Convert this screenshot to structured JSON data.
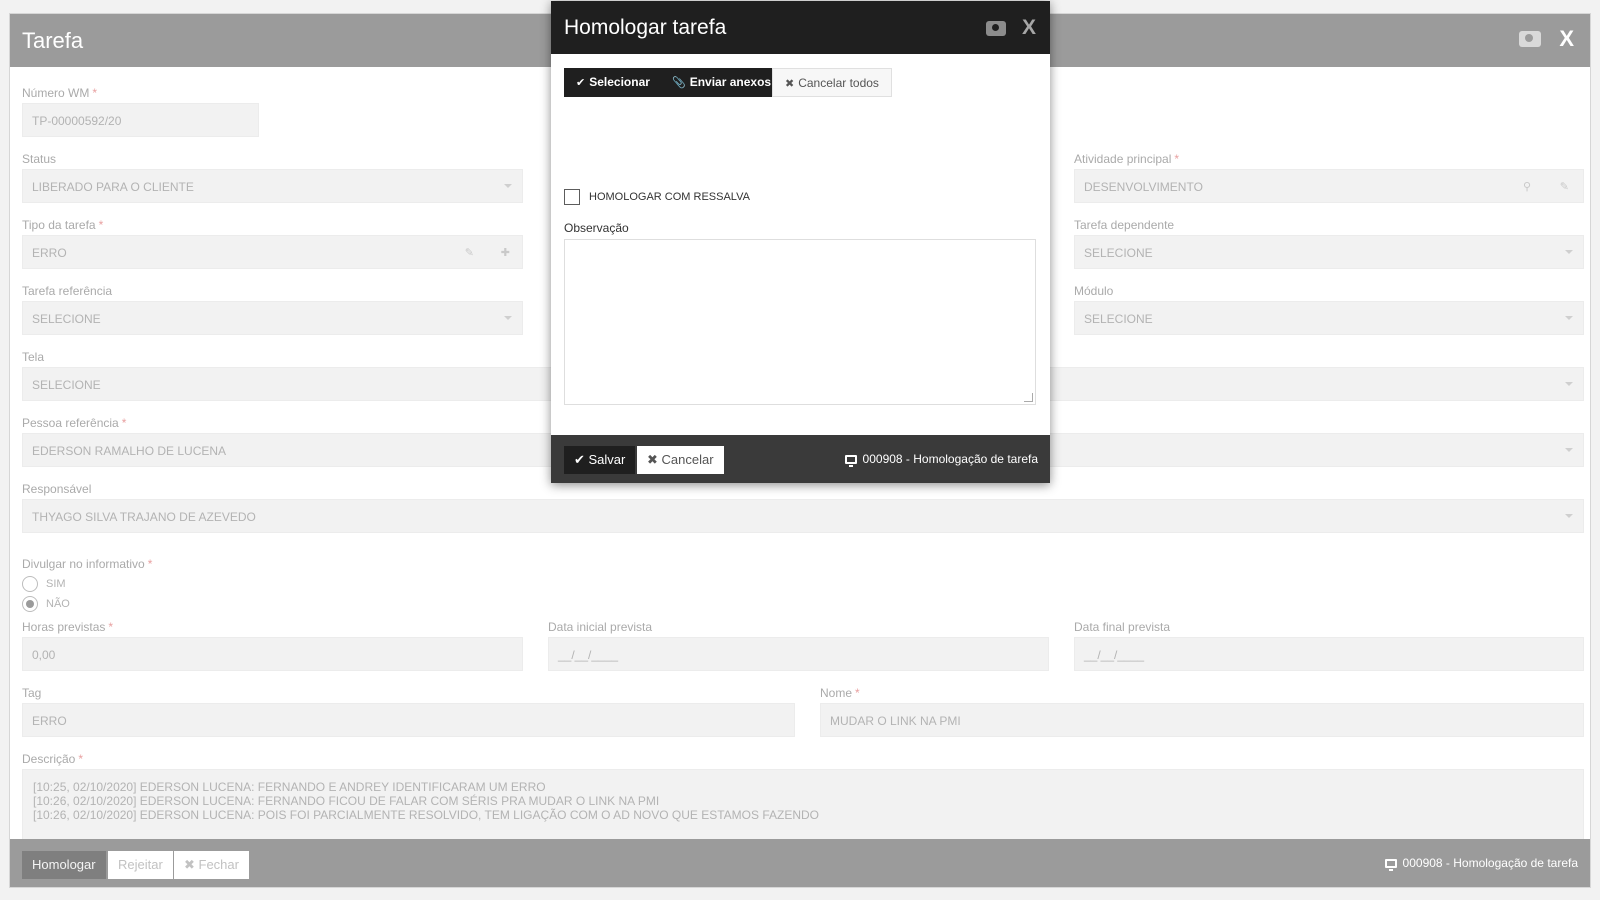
{
  "window": {
    "title": "Tarefa",
    "footer_info": "000908 - Homologação de tarefa",
    "buttons": {
      "homologar": "Homologar",
      "rejeitar": "Rejeitar",
      "fechar": "Fechar"
    }
  },
  "fields": {
    "numero_wm": {
      "label": "Número WM",
      "value": "TP-00000592/20"
    },
    "status": {
      "label": "Status",
      "value": "LIBERADO PARA O CLIENTE"
    },
    "atividade_principal": {
      "label": "Atividade principal",
      "value": "DESENVOLVIMENTO"
    },
    "tipo_tarefa": {
      "label": "Tipo da tarefa",
      "value": "ERRO"
    },
    "tarefa_dependente": {
      "label": "Tarefa dependente",
      "value": "SELECIONE"
    },
    "tarefa_referencia": {
      "label": "Tarefa referência",
      "value": "SELECIONE"
    },
    "modulo": {
      "label": "Módulo",
      "value": "SELECIONE"
    },
    "tela": {
      "label": "Tela",
      "value": "SELECIONE"
    },
    "pessoa_referencia": {
      "label": "Pessoa referência",
      "value": "EDERSON RAMALHO DE LUCENA"
    },
    "responsavel": {
      "label": "Responsável",
      "value": "THYAGO SILVA TRAJANO DE AZEVEDO"
    },
    "divulgar": {
      "label": "Divulgar no informativo",
      "options": [
        "SIM",
        "NÃO"
      ],
      "selected": "NÃO"
    },
    "horas_previstas": {
      "label": "Horas previstas",
      "value": "0,00"
    },
    "data_inicial": {
      "label": "Data inicial prevista",
      "value": "__/__/____"
    },
    "data_final": {
      "label": "Data final prevista",
      "value": "__/__/____"
    },
    "tag": {
      "label": "Tag",
      "value": "ERRO"
    },
    "nome": {
      "label": "Nome",
      "value": "MUDAR O LINK NA PMI"
    },
    "descricao": {
      "label": "Descrição",
      "lines": [
        "[10:25, 02/10/2020] EDERSON LUCENA: FERNANDO E ANDREY IDENTIFICARAM UM ERRO",
        "[10:26, 02/10/2020] EDERSON LUCENA: FERNANDO FICOU DE FALAR COM SÉRIS PRA MUDAR O LINK NA PMI",
        "[10:26, 02/10/2020] EDERSON LUCENA: POIS FOI PARCIALMENTE RESOLVIDO, TEM LIGAÇÃO COM O AD NOVO QUE ESTAMOS FAZENDO"
      ]
    }
  },
  "modal": {
    "title": "Homologar tarefa",
    "buttons": {
      "selecionar": "Selecionar",
      "enviar_anexos": "Enviar anexos",
      "cancelar_todos": "Cancelar todos"
    },
    "checkbox_label": "HOMOLOGAR COM RESSALVA",
    "observacao_label": "Observação",
    "observacao_value": "",
    "footer": {
      "salvar": "Salvar",
      "cancelar": "Cancelar",
      "info": "000908 - Homologação de tarefa"
    }
  },
  "icons": [
    "camera-icon",
    "close-icon",
    "check-icon",
    "paperclip-icon",
    "times-icon",
    "monitor-icon",
    "pencil-icon",
    "plus-icon",
    "search-icon",
    "caret-down-icon"
  ]
}
